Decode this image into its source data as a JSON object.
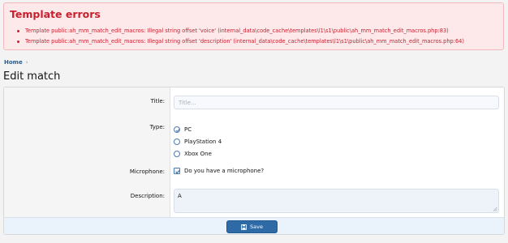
{
  "errors": {
    "title": "Template errors",
    "items": [
      "Template public:ah_mm_match_edit_macros: Illegal string offset 'voice' (internal_data\\code_cache\\templates\\l1\\s1\\public\\ah_mm_match_edit_macros.php:83)",
      "Template public:ah_mm_match_edit_macros: Illegal string offset 'description' (internal_data\\code_cache\\templates\\l1\\s1\\public\\ah_mm_match_edit_macros.php:64)"
    ],
    "color": "#c8202f"
  },
  "breadcrumb": {
    "home": "Home"
  },
  "page": {
    "title": "Edit match"
  },
  "form": {
    "title_label": "Title:",
    "title_placeholder": "Title...",
    "title_value": "",
    "type_label": "Type:",
    "type_options": [
      "PC",
      "PlayStation 4",
      "Xbox One"
    ],
    "type_selected": "PC",
    "microphone_label": "Microphone:",
    "microphone_text": "Do you have a microphone?",
    "microphone_checked": true,
    "description_label": "Description:",
    "description_value": "A",
    "save_label": "Save"
  },
  "colors": {
    "accent": "#2d6aa6",
    "error": "#c8202f"
  }
}
